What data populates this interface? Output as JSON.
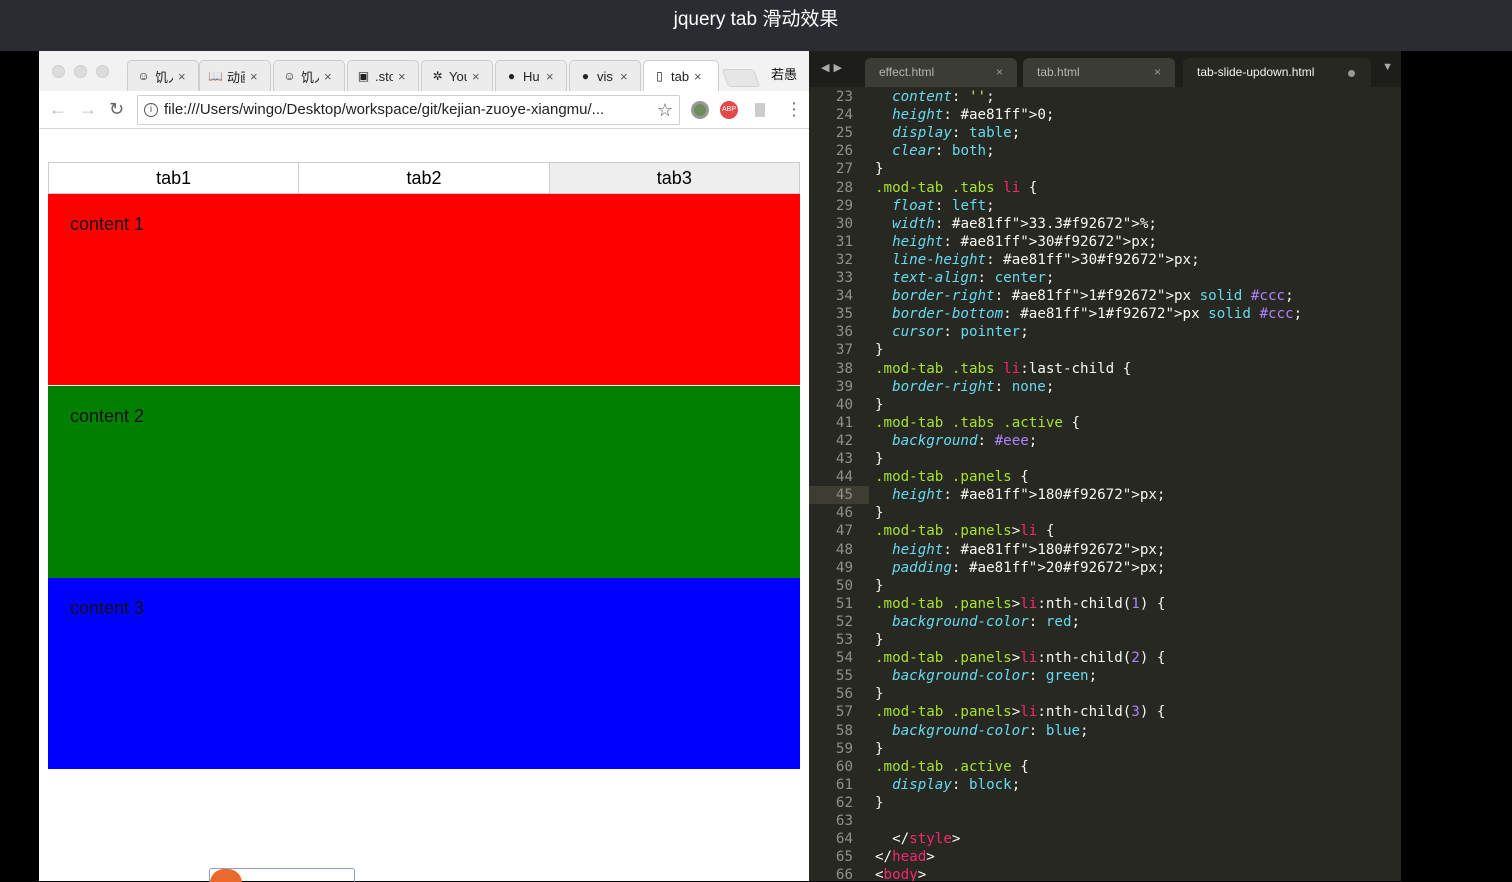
{
  "header": {
    "title": "jquery tab 滑动效果"
  },
  "browser": {
    "tabs": [
      {
        "icon": "ghost-icon",
        "icon_glyph": "☺",
        "label": "饥人",
        "active": false
      },
      {
        "icon": "book-icon",
        "icon_glyph": "📖",
        "label": "动画",
        "active": false
      },
      {
        "icon": "ghost-icon",
        "icon_glyph": "☺",
        "label": "饥人",
        "active": false
      },
      {
        "icon": "stack-icon",
        "icon_glyph": "▣",
        "label": ".sto",
        "active": false
      },
      {
        "icon": "hubspot-icon",
        "icon_glyph": "✲",
        "label": "You",
        "active": false
      },
      {
        "icon": "github-icon",
        "icon_glyph": "●",
        "label": "Hu",
        "active": false
      },
      {
        "icon": "github-icon",
        "icon_glyph": "●",
        "label": "vis",
        "active": false
      },
      {
        "icon": "page-icon",
        "icon_glyph": "▯",
        "label": "tab",
        "active": true
      }
    ],
    "close_glyph": "×",
    "profile": "若愚",
    "url": "file:///Users/wingo/Desktop/workspace/git/kejian-zuoye-xiangmu/...",
    "nav": {
      "back": "←",
      "forward": "→",
      "reload": "↻",
      "star": "☆",
      "menu": "⋮"
    }
  },
  "page": {
    "tabs": [
      "tab1",
      "tab2",
      "tab3"
    ],
    "active_tab": 2,
    "panels": [
      {
        "label": "content 1",
        "color": "#ff0000"
      },
      {
        "label": "content 2",
        "color": "#008000"
      },
      {
        "label": "content 3",
        "color": "#0000ff"
      }
    ]
  },
  "editor": {
    "tabs": [
      {
        "label": "effect.html",
        "modified": false
      },
      {
        "label": "tab.html",
        "modified": false
      },
      {
        "label": "tab-slide-updown.html",
        "modified": true
      }
    ],
    "current_line": 45,
    "lines": [
      {
        "n": "23",
        "t": "  content: '';"
      },
      {
        "n": "24",
        "t": "  height: 0;"
      },
      {
        "n": "25",
        "t": "  display: table;"
      },
      {
        "n": "26",
        "t": "  clear: both;"
      },
      {
        "n": "27",
        "t": "}"
      },
      {
        "n": "28",
        "t": ".mod-tab .tabs li {"
      },
      {
        "n": "29",
        "t": "  float: left;"
      },
      {
        "n": "30",
        "t": "  width: 33.3%;"
      },
      {
        "n": "31",
        "t": "  height: 30px;"
      },
      {
        "n": "32",
        "t": "  line-height: 30px;"
      },
      {
        "n": "33",
        "t": "  text-align: center;"
      },
      {
        "n": "34",
        "t": "  border-right: 1px solid #ccc;"
      },
      {
        "n": "35",
        "t": "  border-bottom: 1px solid #ccc;"
      },
      {
        "n": "36",
        "t": "  cursor: pointer;"
      },
      {
        "n": "37",
        "t": "}"
      },
      {
        "n": "38",
        "t": ".mod-tab .tabs li:last-child {"
      },
      {
        "n": "39",
        "t": "  border-right: none;"
      },
      {
        "n": "40",
        "t": "}"
      },
      {
        "n": "41",
        "t": ".mod-tab .tabs .active {"
      },
      {
        "n": "42",
        "t": "  background: #eee;"
      },
      {
        "n": "43",
        "t": "}"
      },
      {
        "n": "44",
        "t": ".mod-tab .panels {"
      },
      {
        "n": "45",
        "t": "  height: 180px;"
      },
      {
        "n": "46",
        "t": "}"
      },
      {
        "n": "47",
        "t": ".mod-tab .panels>li {"
      },
      {
        "n": "48",
        "t": "  height: 180px;"
      },
      {
        "n": "49",
        "t": "  padding: 20px;"
      },
      {
        "n": "50",
        "t": "}"
      },
      {
        "n": "51",
        "t": ".mod-tab .panels>li:nth-child(1) {"
      },
      {
        "n": "52",
        "t": "  background-color: red;"
      },
      {
        "n": "53",
        "t": "}"
      },
      {
        "n": "54",
        "t": ".mod-tab .panels>li:nth-child(2) {"
      },
      {
        "n": "55",
        "t": "  background-color: green;"
      },
      {
        "n": "56",
        "t": "}"
      },
      {
        "n": "57",
        "t": ".mod-tab .panels>li:nth-child(3) {"
      },
      {
        "n": "58",
        "t": "  background-color: blue;"
      },
      {
        "n": "59",
        "t": "}"
      },
      {
        "n": "60",
        "t": ".mod-tab .active {"
      },
      {
        "n": "61",
        "t": "  display: block;"
      },
      {
        "n": "62",
        "t": "}"
      },
      {
        "n": "63",
        "t": ""
      },
      {
        "n": "64",
        "t": "  </style>"
      },
      {
        "n": "65",
        "t": "</head>"
      },
      {
        "n": "66",
        "t": "<body>"
      }
    ]
  },
  "colors": {
    "selector": "#a6e22e",
    "property": "#66d9ef",
    "keyword": "#f92672",
    "number": "#ae81ff",
    "text": "#f8f8f2"
  }
}
